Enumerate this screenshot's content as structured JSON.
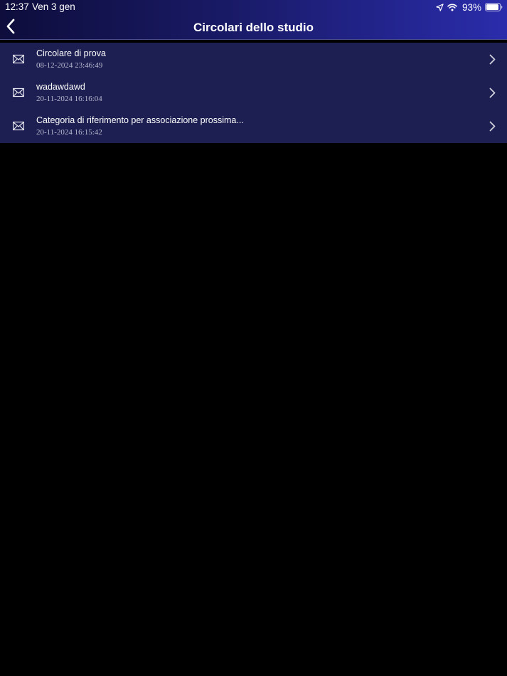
{
  "status_bar": {
    "time": "12:37",
    "date": "Ven 3 gen",
    "battery_percent": "93%",
    "battery_level": 0.93
  },
  "nav": {
    "title": "Circolari dello studio",
    "back_icon": "chevron-left-icon"
  },
  "circolari": [
    {
      "title": "Circolare di prova",
      "date": "08-12-2024 23:46:49",
      "icon": "envelope-icon"
    },
    {
      "title": "wadawdawd",
      "date": "20-11-2024 16:16:04",
      "icon": "envelope-icon"
    },
    {
      "title": "Categoria di riferimento per associazione prossima...",
      "date": "20-11-2024 16:15:42",
      "icon": "envelope-icon"
    }
  ],
  "colors": {
    "header_gradient_start": "#0e0d3c",
    "header_gradient_end": "#2a2cab",
    "list_background": "#1d1f52",
    "background": "#000000"
  }
}
